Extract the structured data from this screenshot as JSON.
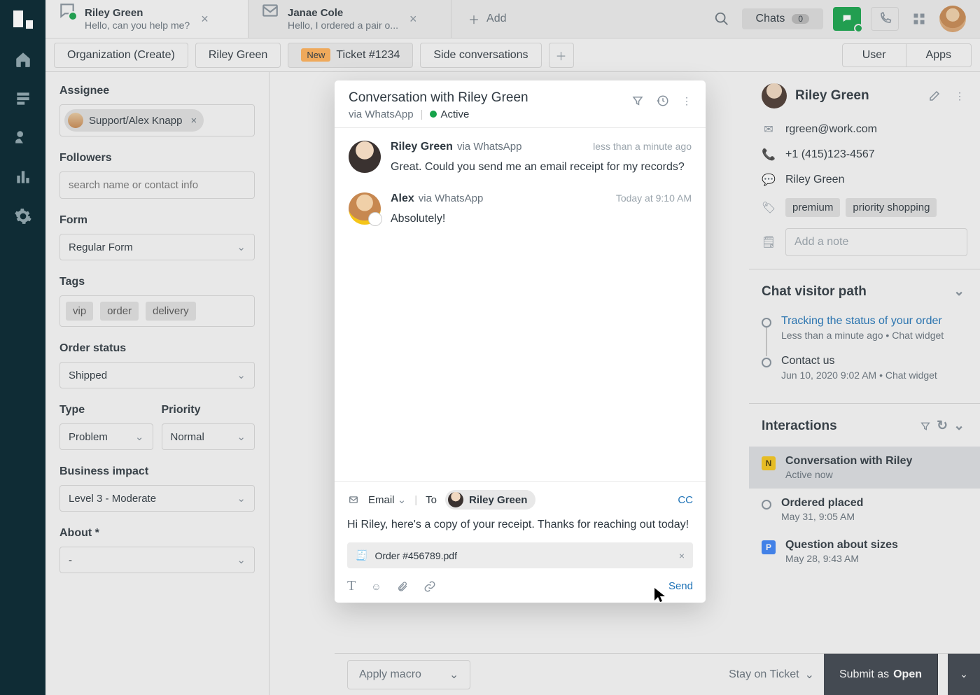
{
  "tabs": [
    {
      "title": "Riley Green",
      "sub": "Hello, can you help me?",
      "icon": "chat",
      "online": true
    },
    {
      "title": "Janae Cole",
      "sub": "Hello, I ordered a pair o...",
      "icon": "email",
      "online": false
    }
  ],
  "addTab": "Add",
  "chats": {
    "label": "Chats",
    "count": "0"
  },
  "subtabs": {
    "org": "Organization (Create)",
    "person": "Riley Green",
    "ticketBadge": "New",
    "ticket": "Ticket #1234",
    "side": "Side conversations",
    "user": "User",
    "apps": "Apps"
  },
  "props": {
    "assigneeLabel": "Assignee",
    "assignee": "Support/Alex Knapp",
    "followersLabel": "Followers",
    "followersPlaceholder": "search name or contact info",
    "formLabel": "Form",
    "form": "Regular Form",
    "tagsLabel": "Tags",
    "tags": [
      "vip",
      "order",
      "delivery"
    ],
    "orderStatusLabel": "Order status",
    "orderStatus": "Shipped",
    "typeLabel": "Type",
    "type": "Problem",
    "priorityLabel": "Priority",
    "priority": "Normal",
    "bizLabel": "Business impact",
    "biz": "Level 3 - Moderate",
    "aboutLabel": "About *",
    "about": "-"
  },
  "conv": {
    "title": "Conversation with Riley Green",
    "via": "via WhatsApp",
    "status": "Active",
    "messages": [
      {
        "name": "Riley Green",
        "via": "via WhatsApp",
        "time": "less than a minute ago",
        "text": "Great. Could you send me an email receipt for my records?"
      },
      {
        "name": "Alex",
        "via": "via WhatsApp",
        "time": "Today at 9:10 AM",
        "text": "Absolutely!"
      }
    ],
    "composer": {
      "channel": "Email",
      "toLabel": "To",
      "to": "Riley Green",
      "cc": "CC",
      "body": "Hi Riley, here's a copy of your receipt. Thanks for reaching out today!",
      "attachment": "Order #456789.pdf",
      "send": "Send"
    }
  },
  "right": {
    "name": "Riley Green",
    "email": "rgreen@work.com",
    "phone": "+1 (415)123-4567",
    "whatsapp": "Riley Green",
    "tags": [
      "premium",
      "priority shopping"
    ],
    "notePlaceholder": "Add a note",
    "chatPathTitle": "Chat visitor path",
    "path": [
      {
        "title": "Tracking the status of your order",
        "sub": "Less than a minute ago • Chat widget",
        "link": true
      },
      {
        "title": "Contact us",
        "sub": "Jun 10, 2020 9:02 AM • Chat widget",
        "link": false
      }
    ],
    "interactionsTitle": "Interactions",
    "interactions": [
      {
        "badge": "N",
        "title": "Conversation with Riley",
        "sub": "Active now",
        "active": true
      },
      {
        "badge": "",
        "title": "Ordered placed",
        "sub": "May 31, 9:05 AM"
      },
      {
        "badge": "P",
        "title": "Question about sizes",
        "sub": "May 28, 9:43 AM"
      }
    ]
  },
  "bottom": {
    "macro": "Apply macro",
    "stay": "Stay on Ticket",
    "submit": "Submit as ",
    "submitState": "Open"
  }
}
